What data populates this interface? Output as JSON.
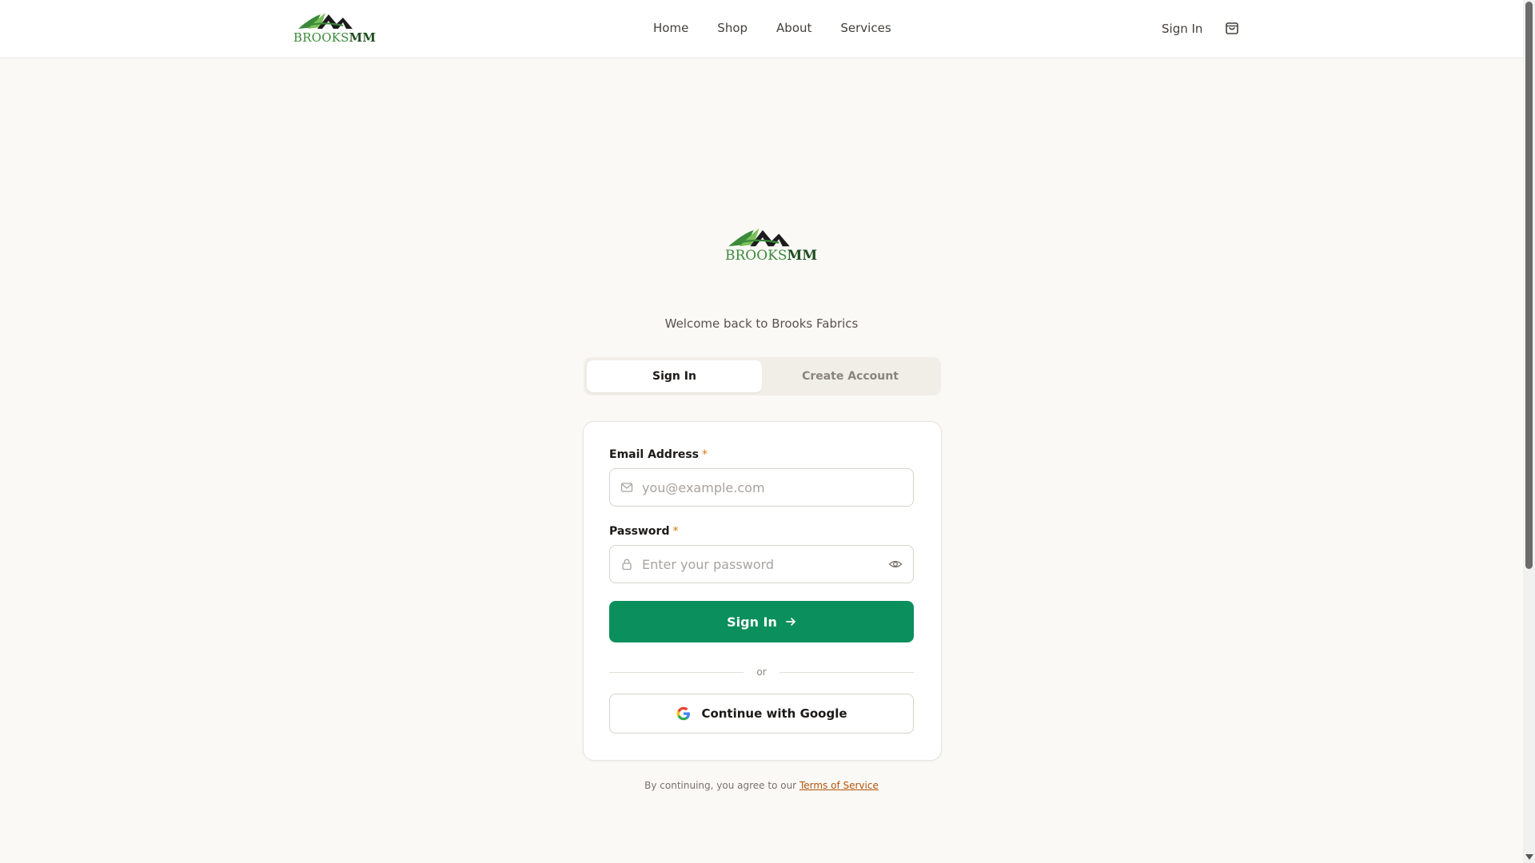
{
  "brand": {
    "logo_light": "BROOKS",
    "logo_dark": "MM",
    "color_light": "#3a8a3a",
    "color_dark": "#1e4d1e"
  },
  "nav": {
    "items": [
      "Home",
      "Shop",
      "About",
      "Services"
    ],
    "sign_in": "Sign In",
    "cart_icon": "shopping-bag-icon"
  },
  "welcome": "Welcome back to Brooks Fabrics",
  "tabs": {
    "sign_in": "Sign In",
    "create_account": "Create Account",
    "active": "sign_in"
  },
  "form": {
    "email_label": "Email Address",
    "required_mark": "*",
    "email_placeholder": "you@example.com",
    "email_value": "",
    "password_label": "Password",
    "password_placeholder": "Enter your password",
    "password_value": "",
    "submit": "Sign In",
    "divider": "or",
    "google": "Continue with Google"
  },
  "terms": {
    "prefix": "By continuing, you agree to our",
    "link": "Terms of Service"
  },
  "colors": {
    "accent": "#0b8f5c",
    "link": "#b45309",
    "background": "#faf9f6"
  }
}
